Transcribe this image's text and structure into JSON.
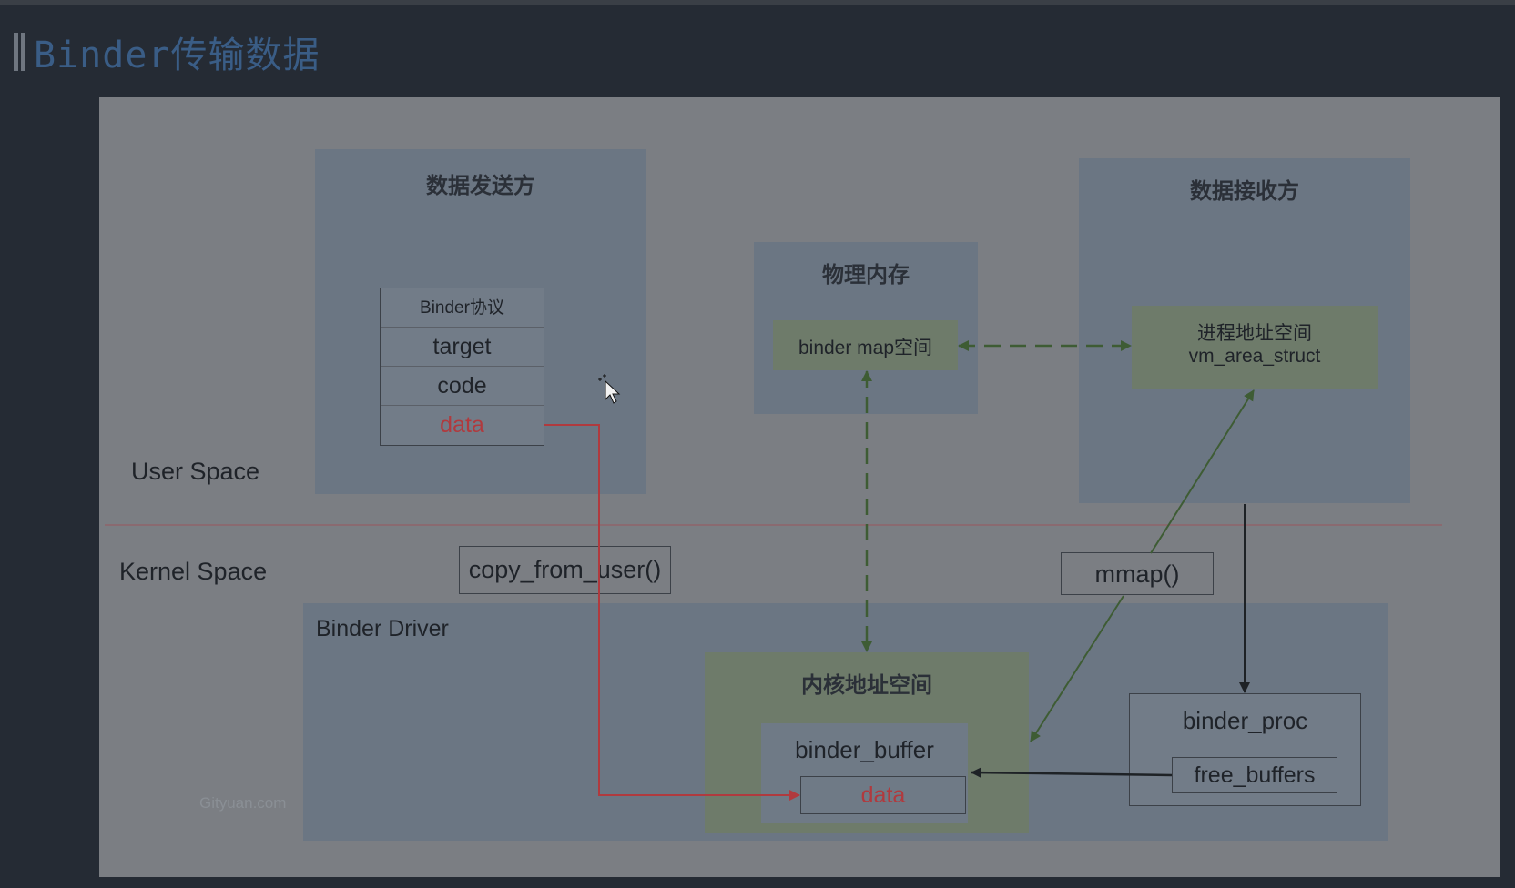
{
  "header": {
    "title": "Binder传输数据"
  },
  "diagram": {
    "sender": {
      "title": "数据发送方"
    },
    "protocol": {
      "header": "Binder协议",
      "target": "target",
      "code": "code",
      "data": "data"
    },
    "physical_memory": {
      "title": "物理内存",
      "map_space": "binder map空间"
    },
    "receiver": {
      "title": "数据接收方",
      "vm_line1": "进程地址空间",
      "vm_line2": "vm_area_struct"
    },
    "user_space": "User Space",
    "kernel_space": "Kernel Space",
    "copy_from_user": "copy_from_user()",
    "mmap": "mmap()",
    "binder_driver": "Binder Driver",
    "kernel_address": {
      "title": "内核地址空间",
      "buffer": "binder_buffer",
      "data": "data"
    },
    "binder_proc": {
      "title": "binder_proc",
      "free_buffers": "free_buffers"
    },
    "watermark": "Gityuan.com"
  },
  "colors": {
    "data_arrow": "#b03a3e",
    "dashed_arrow": "#3e5c34",
    "mmap_arrow": "#3e5c34",
    "black_arrow": "#1e2226"
  }
}
